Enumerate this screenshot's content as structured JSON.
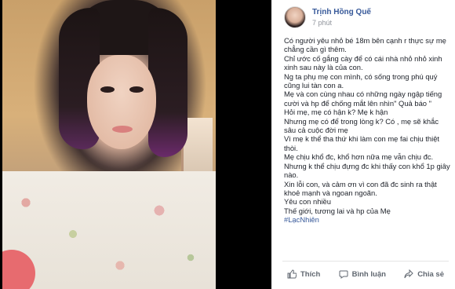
{
  "post": {
    "author": "Trịnh Hồng Quế",
    "time": "7 phút",
    "lines": [
      "Có người yêu nhỏ bé 18m bên cạnh r thực sự mẹ chẳng cần gì thêm.",
      "Chỉ ước cố gắng cày để có cái nhà nhỏ nhỏ xinh xinh sau này là của con.",
      "Ng ta phụ mẹ con mình, có sống trong phú quý cũng lui tàn con a.",
      "Mẹ và con cùng nhau có những ngày ngập tiếng cười và hp để chống mắt lên nhìn\" Quả báo \"",
      "Hỏi mẹ, mẹ có hận k? Mẹ k hận",
      "Nhưng mẹ có để trong lòng k? Có , mẹ sẽ khắc sâu cả cuộc đời mẹ",
      "Vì mẹ k thể tha thứ khi làm con mẹ fai chịu thiệt thòi.",
      "Mẹ chịu khổ đc, khổ hơn nữa mẹ vẫn chịu đc.",
      "Nhưng k thể chịu đựng đc khi thấy con khổ 1p giây nào.",
      "Xin lỗi con, và cảm ơn vì con đã đc sinh ra thật khoẻ mạnh và ngoan ngoãn.",
      "Yêu con nhiều",
      "Thế giới, tương lai và hp của Mẹ"
    ],
    "hashtag": "#LạcNhiên"
  },
  "actions": {
    "like": "Thích",
    "comment": "Bình luận",
    "share": "Chia sẻ"
  },
  "colors": {
    "link": "#365899",
    "text": "#1d2129",
    "muted": "#90949c",
    "action": "#606770"
  }
}
